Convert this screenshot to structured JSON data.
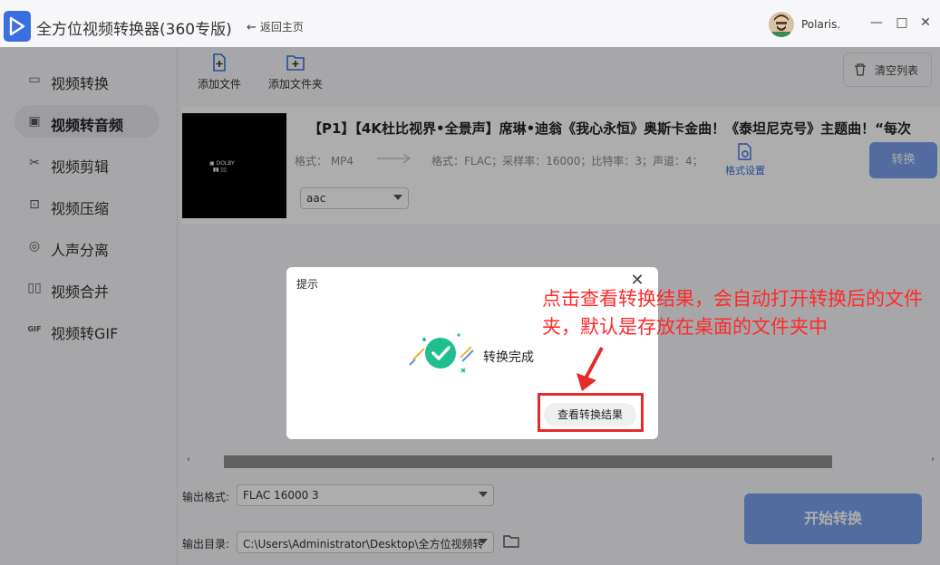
{
  "app": {
    "title": "全方位视频转换器(360专版)",
    "back_home": "返回主页",
    "username": "Polaris."
  },
  "window_controls": {
    "minimize": "—",
    "maximize": "□",
    "close": "✕"
  },
  "sidebar": {
    "items": [
      {
        "label": "视频转换",
        "icon": "video-convert-icon",
        "active": false
      },
      {
        "label": "视频转音频",
        "icon": "video-to-audio-icon",
        "active": true
      },
      {
        "label": "视频剪辑",
        "icon": "scissors-icon",
        "active": false
      },
      {
        "label": "视频压缩",
        "icon": "compress-icon",
        "active": false
      },
      {
        "label": "人声分离",
        "icon": "voice-separate-icon",
        "active": false
      },
      {
        "label": "视频合并",
        "icon": "merge-icon",
        "active": false
      },
      {
        "label": "视频转GIF",
        "icon": "gif-icon",
        "active": false
      }
    ]
  },
  "toolbar": {
    "add_file": "添加文件",
    "add_folder": "添加文件夹",
    "clear_list": "清空列表"
  },
  "file": {
    "title": "【P1】【4K杜比视界•全景声】席琳•迪翁《我心永恒》奥斯卡金曲！《泰坦尼克号》主题曲！“每次",
    "src_format": "格式：  MP4",
    "dst_format": "格式：FLAC；采样率：16000；比特率：3；声道：4；",
    "format_settings": "格式设置",
    "convert": "转换",
    "audio_codec": "aac"
  },
  "output": {
    "format_label": "输出格式:",
    "format_value": "FLAC 16000 3",
    "dir_label": "输出目录:",
    "dir_value": "C:\\Users\\Administrator\\Desktop\\全方位视频转",
    "start": "开始转换"
  },
  "dialog": {
    "title": "提示",
    "message": "转换完成",
    "view_result": "查看转换结果"
  },
  "annotation": {
    "text": "点击查看转换结果，会自动打开转换后的文件夹，默认是存放在桌面的文件夹中"
  },
  "colors": {
    "accent": "#3b6fe0",
    "button_disabled": "#7aa0ec",
    "success": "#1fbf8f",
    "annotation": "#ff2a2a"
  }
}
